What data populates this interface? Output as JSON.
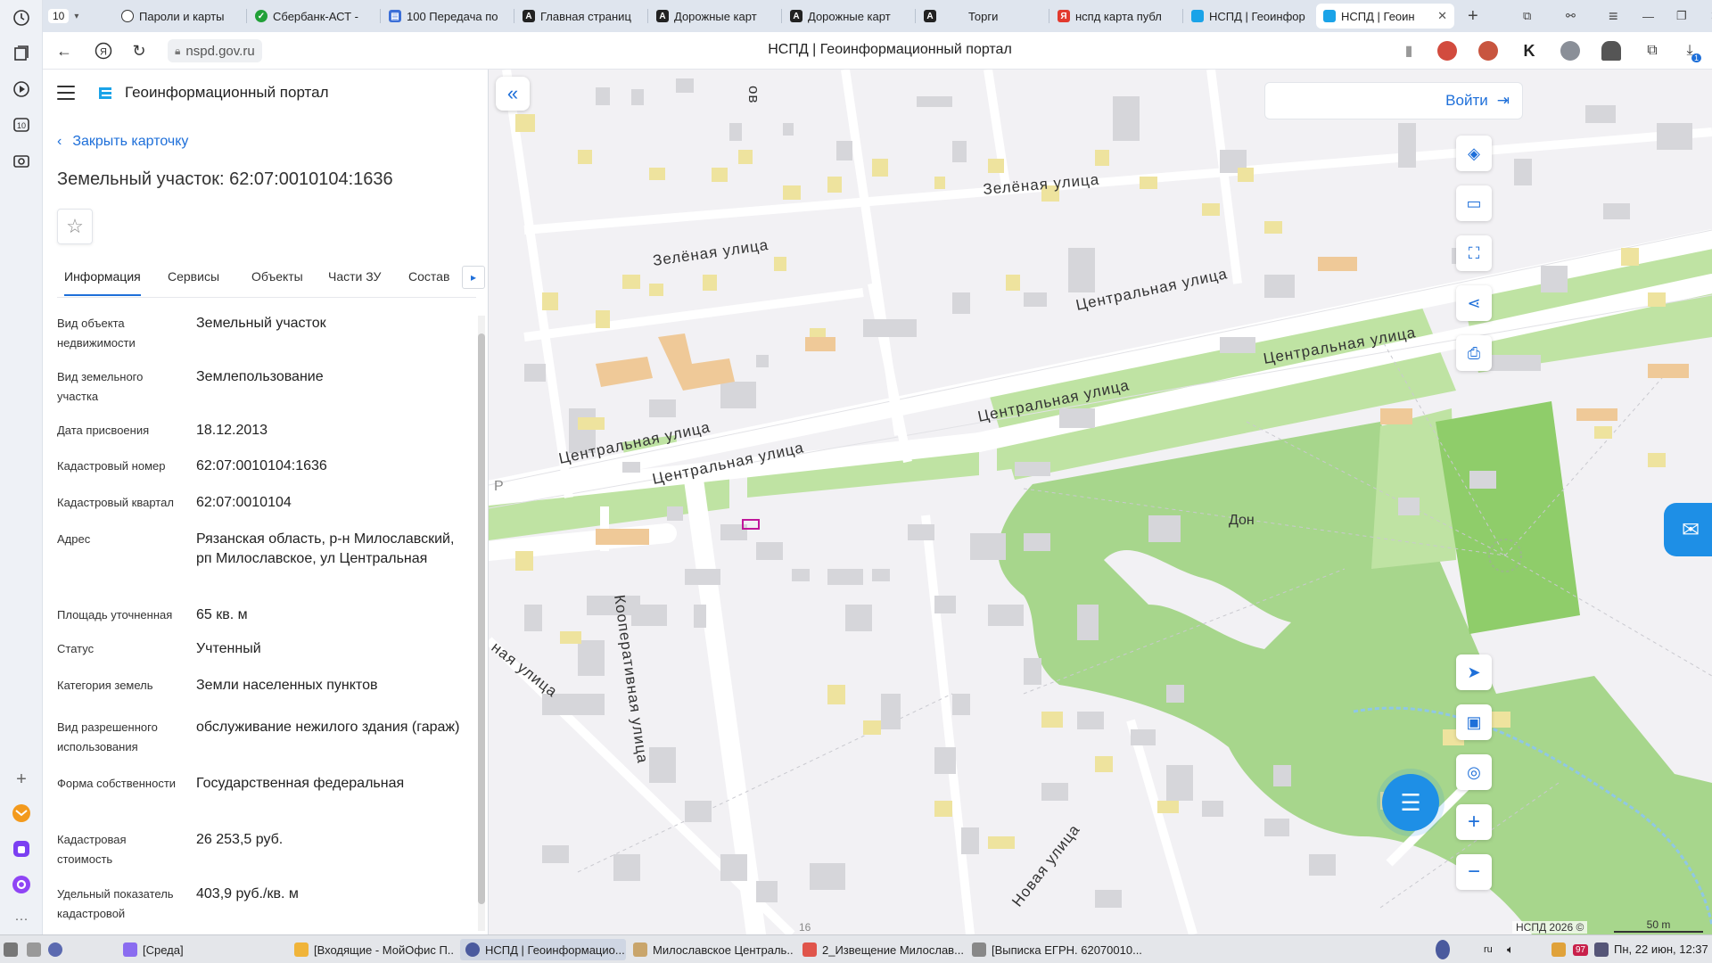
{
  "browser": {
    "tab_counter": "10",
    "tabs": [
      {
        "label": "Пароли и карты",
        "color": "#333333"
      },
      {
        "label": "Сбербанк-АСТ -",
        "color": "#21a038"
      },
      {
        "label": "100 Передача по",
        "color": "#3b6fd8"
      },
      {
        "label": "Главная страниц",
        "color": "#222222"
      },
      {
        "label": "Дорожные карт",
        "color": "#222222"
      },
      {
        "label": "Дорожные карт",
        "color": "#222222"
      },
      {
        "label": "Торги",
        "color": "#222222"
      },
      {
        "label": "нспд карта публ",
        "color": "#e23a2e"
      },
      {
        "label": "НСПД | Геоинфор",
        "color": "#1aa3e8"
      },
      {
        "label": "НСПД | Геоин",
        "color": "#1aa3e8",
        "active": true
      }
    ],
    "url": "nspd.gov.ru",
    "page_title": "НСПД | Геоинформационный портал",
    "download_badge": "1"
  },
  "panel": {
    "portal_name": "Геоинформационный портал",
    "close_card": "Закрыть карточку",
    "title": "Земельный участок: 62:07:0010104:1636",
    "tabs": [
      "Информация",
      "Сервисы",
      "Объекты",
      "Части ЗУ",
      "Состав"
    ],
    "rows": [
      {
        "label": "Вид объекта недвижимости",
        "value": "Земельный участок"
      },
      {
        "label": "Вид земельного участка",
        "value": "Землепользование"
      },
      {
        "label": "Дата присвоения",
        "value": "18.12.2013"
      },
      {
        "label": "Кадастровый номер",
        "value": "62:07:0010104:1636"
      },
      {
        "label": "Кадастровый квартал",
        "value": "62:07:0010104"
      },
      {
        "label": "Адрес",
        "value": "Рязанская область, р-н Милославский, рп Милославское, ул Центральная"
      },
      {
        "label": "Площадь уточненная",
        "value": "65 кв. м"
      },
      {
        "label": "Статус",
        "value": "Учтенный"
      },
      {
        "label": "Категория земель",
        "value": "Земли населенных пунктов"
      },
      {
        "label": "Вид разрешенного использования",
        "value": "обслуживание нежилого здания (гараж)"
      },
      {
        "label": "Форма собственности",
        "value": "Государственная федеральная"
      },
      {
        "label": "Кадастровая стоимость",
        "value": "26 253,5 руб."
      },
      {
        "label": "Удельный показатель кадастровой стоимости",
        "value": "403,9 руб./кв. м"
      }
    ]
  },
  "map": {
    "login": "Войти",
    "streets": {
      "zelenaya": "Зелёная улица",
      "tsentralnaya": "Центральная улица",
      "kooperativnaya": "Кооперативная улица",
      "novaya": "Новая улица",
      "naya": "ная улица",
      "ov": "ов"
    },
    "stadium": "Дон",
    "parking": "P",
    "copyright": "НСПД 2026 ©",
    "scale": "50 m",
    "house_number": "16"
  },
  "taskbar": {
    "items": [
      "[Среда]",
      "[Входящие - МойОфис П...",
      "НСПД | Геоинформацио...",
      "Милославское Централь...",
      "2_Извещение Милослав...",
      "[Выписка ЕГРН. 62070010..."
    ],
    "lang": "ru",
    "clock": "Пн, 22 июн, 12:37",
    "badge": "97"
  }
}
